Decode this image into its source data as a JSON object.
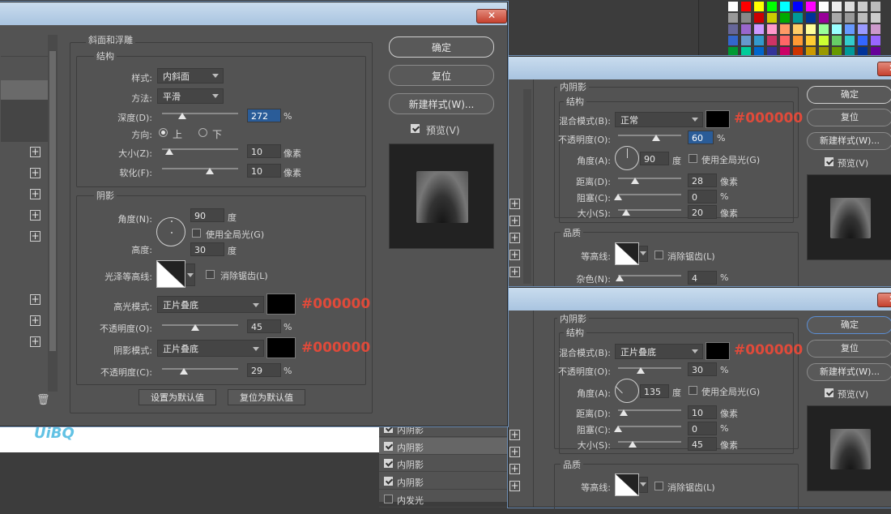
{
  "main": {
    "group_title": "斜面和浮雕",
    "structure": {
      "title": "结构",
      "style_label": "样式:",
      "style_value": "内斜面",
      "technique_label": "方法:",
      "technique_value": "平滑",
      "depth_label": "深度(D):",
      "depth_value": "272",
      "depth_unit": "%",
      "direction_label": "方向:",
      "direction_up": "上",
      "direction_down": "下",
      "size_label": "大小(Z):",
      "size_value": "10",
      "size_unit": "像素",
      "soften_label": "软化(F):",
      "soften_value": "10",
      "soften_unit": "像素"
    },
    "shading": {
      "title": "阴影",
      "angle_label": "角度(N):",
      "angle_value": "90",
      "angle_unit": "度",
      "global_light": "使用全局光(G)",
      "altitude_label": "高度:",
      "altitude_value": "30",
      "altitude_unit": "度",
      "gloss_label": "光泽等高线:",
      "anti_alias": "消除锯齿(L)",
      "highlight_mode_label": "高光模式:",
      "highlight_mode_value": "正片叠底",
      "highlight_hex": "#000000",
      "highlight_opacity_label": "不透明度(O):",
      "highlight_opacity_value": "45",
      "shadow_mode_label": "阴影模式:",
      "shadow_mode_value": "正片叠底",
      "shadow_hex": "#000000",
      "shadow_opacity_label": "不透明度(C):",
      "shadow_opacity_value": "29",
      "percent": "%"
    },
    "make_default": "设置为默认值",
    "reset_default": "复位为默认值",
    "ok": "确定",
    "reset": "复位",
    "new_style": "新建样式(W)...",
    "preview": "预览(V)",
    "close": "✕"
  },
  "dialog2": {
    "group_title": "内阴影",
    "structure_title": "结构",
    "blend_label": "混合模式(B):",
    "blend_value": "正常",
    "hex": "#000000",
    "opacity_label": "不透明度(O):",
    "opacity_value": "60",
    "angle_label": "角度(A):",
    "angle_value": "90",
    "angle_unit": "度",
    "global_light": "使用全局光(G)",
    "distance_label": "距离(D):",
    "distance_value": "28",
    "choke_label": "阻塞(C):",
    "choke_value": "0",
    "size_label": "大小(S):",
    "size_value": "20",
    "px": "像素",
    "percent": "%",
    "quality_title": "品质",
    "contour_label": "等高线:",
    "anti_alias": "消除锯齿(L)",
    "noise_label": "杂色(N):",
    "noise_value": "4",
    "ok": "确定",
    "reset": "复位",
    "new_style": "新建样式(W)...",
    "preview": "预览(V)",
    "close": "✕"
  },
  "dialog3": {
    "group_title": "内阴影",
    "structure_title": "结构",
    "blend_label": "混合模式(B):",
    "blend_value": "正片叠底",
    "hex": "#000000",
    "opacity_label": "不透明度(O):",
    "opacity_value": "30",
    "angle_label": "角度(A):",
    "angle_value": "135",
    "angle_unit": "度",
    "global_light": "使用全局光(G)",
    "distance_label": "距离(D):",
    "distance_value": "10",
    "choke_label": "阻塞(C):",
    "choke_value": "0",
    "size_label": "大小(S):",
    "size_value": "45",
    "px": "像素",
    "percent": "%",
    "quality_title": "品质",
    "contour_label": "等高线:",
    "anti_alias": "消除锯齿(L)",
    "ok": "确定",
    "reset": "复位",
    "new_style": "新建样式(W)...",
    "preview": "预览(V)",
    "close": "✕"
  },
  "layer_list": {
    "items": [
      "内阴影",
      "内阴影",
      "内阴影",
      "内阴影",
      "内发光"
    ]
  },
  "watermark": "UiBQ",
  "colors": {
    "accent_hex": "#e04a3a",
    "dialog_bg": "#535353",
    "title_bar": "#b9d1ea"
  }
}
